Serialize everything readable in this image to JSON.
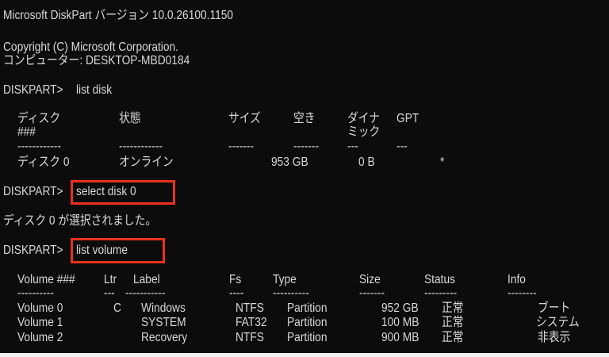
{
  "title_line": "Microsoft DiskPart バージョン 10.0.26100.1150",
  "copyright": "Copyright (C) Microsoft Corporation.",
  "computer": "コンピューター: DESKTOP-MBD0184",
  "prompt": "DISKPART>",
  "cmd1": "list disk",
  "disk_table": {
    "headers": [
      "ディスク",
      "状態",
      "サイズ",
      "空き",
      "ダイナ",
      "GPT"
    ],
    "header_line2": [
      "###",
      "ミック"
    ],
    "dashes": [
      "------------",
      "------------",
      "-------",
      "-------",
      "---",
      "---"
    ],
    "row": [
      "ディスク 0",
      "オンライン",
      "953 GB",
      "0 B",
      "*"
    ]
  },
  "cmd2": "select disk 0",
  "msg": "ディスク 0 が選択されました。",
  "cmd3": "list volume",
  "volume_table": {
    "headers": [
      "Volume ###",
      "Ltr",
      "Label",
      "Fs",
      "Type",
      "Size",
      "Status",
      "Info"
    ],
    "dashes": [
      "----------",
      "---",
      "-----------",
      "----",
      "----------",
      "-------",
      "---------",
      "--------"
    ],
    "rows": [
      [
        "Volume 0",
        "C",
        "Windows",
        "NTFS",
        "Partition",
        "952 GB",
        "正常",
        "ブート"
      ],
      [
        "Volume 1",
        "",
        "SYSTEM",
        "FAT32",
        "Partition",
        "100 MB",
        "正常",
        "システム"
      ],
      [
        "Volume 2",
        "",
        "Recovery",
        "NTFS",
        "Partition",
        "900 MB",
        "正常",
        "非表示"
      ]
    ]
  },
  "colors": {
    "background": "#0c0c0c",
    "text": "#d8d8d8",
    "highlight": "#e8321e"
  }
}
